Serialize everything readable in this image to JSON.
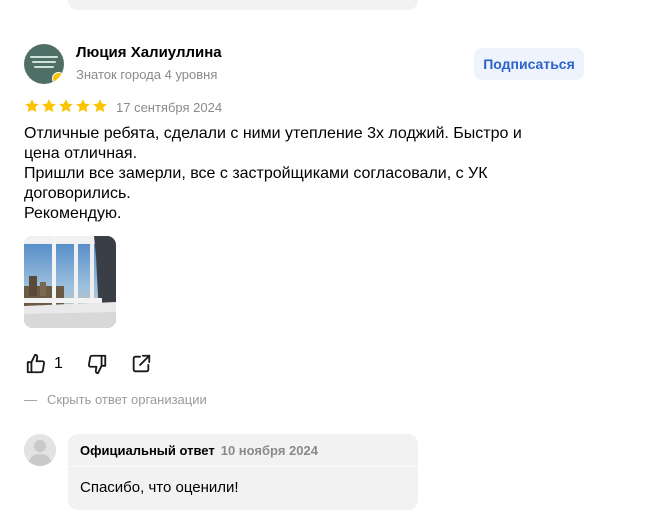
{
  "review": {
    "author_name": "Люция Халиуллина",
    "author_level": "Знаток города 4 уровня",
    "subscribe_label": "Подписаться",
    "rating": 5,
    "rating_max": 5,
    "date": "17 сентября 2024",
    "text_lines": [
      "Отличные ребята, сделали с ними утепление 3х лоджий. Быстро и цена отличная.",
      "Пришли все замерли, все с застройщиками согласовали, с УК договорились.",
      "Рекомендую."
    ],
    "likes_count": "1",
    "hide_answer_label": "Скрыть ответ организации",
    "hide_answer_dash": "—",
    "star_color": "#fcc400"
  },
  "official_answer": {
    "label": "Официальный ответ",
    "date": "10 ноября 2024",
    "text": "Спасибо, что оценили!"
  },
  "colors": {
    "accent": "#2d62c8",
    "muted": "#8a8a8a",
    "card_bg": "#f2f2f2"
  },
  "icons": {
    "like": "thumbs-up-icon",
    "dislike": "thumbs-down-icon",
    "share": "share-icon"
  }
}
